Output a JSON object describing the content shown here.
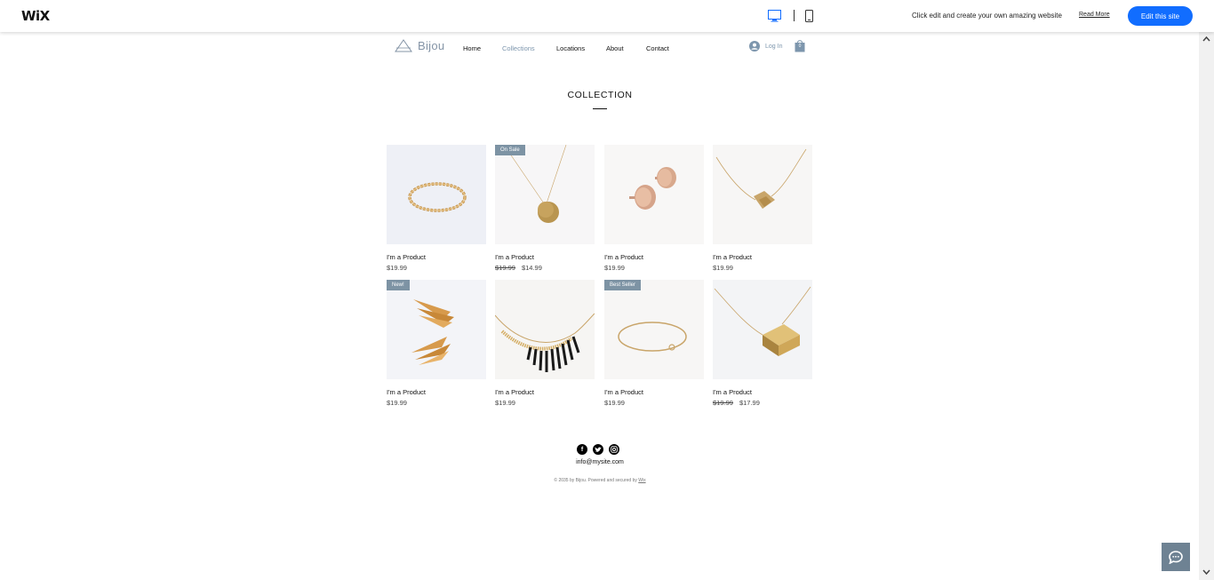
{
  "wixbar": {
    "logo": "WiX",
    "promo_text": "Click edit and create your own amazing website",
    "read_more": "Read More",
    "edit_button": "Edit this site"
  },
  "site": {
    "logo_text": "Bijou",
    "nav": [
      {
        "label": "Home"
      },
      {
        "label": "Collections"
      },
      {
        "label": "Locations"
      },
      {
        "label": "About"
      },
      {
        "label": "Contact"
      }
    ],
    "login": "Log In",
    "cart_count": "0"
  },
  "main": {
    "title": "COLLECTION",
    "products": [
      {
        "name": "I'm a Product",
        "price": "$19.99",
        "old_price": "",
        "badge": ""
      },
      {
        "name": "I'm a Product",
        "price": "$14.99",
        "old_price": "$19.99",
        "badge": "On Sale"
      },
      {
        "name": "I'm a Product",
        "price": "$19.99",
        "old_price": "",
        "badge": ""
      },
      {
        "name": "I'm a Product",
        "price": "$19.99",
        "old_price": "",
        "badge": ""
      },
      {
        "name": "I'm a Product",
        "price": "$19.99",
        "old_price": "",
        "badge": "New!"
      },
      {
        "name": "I'm a Product",
        "price": "$19.99",
        "old_price": "",
        "badge": ""
      },
      {
        "name": "I'm a Product",
        "price": "$19.99",
        "old_price": "",
        "badge": "Best Seller"
      },
      {
        "name": "I'm a Product",
        "price": "$17.99",
        "old_price": "$19.99",
        "badge": ""
      }
    ]
  },
  "footer": {
    "socials": [
      "facebook-icon",
      "twitter-icon",
      "instagram-icon"
    ],
    "email": "info@mysite.com",
    "copyright": "© 2035 by Bijou. Powered and secured by",
    "wix_link": "Wix"
  },
  "colors": {
    "accent": "#116dff",
    "brand": "#7d96ad",
    "badge": "#7d93a4"
  }
}
